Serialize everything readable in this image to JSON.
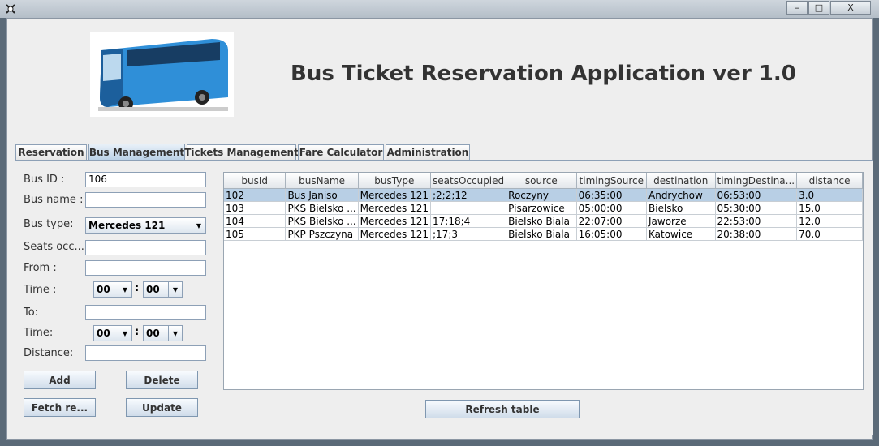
{
  "window": {
    "title": "",
    "minimize_label": "–",
    "maximize_label": "□",
    "close_label": "X"
  },
  "header": {
    "app_title": "Bus Ticket Reservation Application ver 1.0"
  },
  "tabs": [
    {
      "label": "Reservation"
    },
    {
      "label": "Bus Management"
    },
    {
      "label": "Tickets Management"
    },
    {
      "label": "Fare Calculator"
    },
    {
      "label": "Administration"
    }
  ],
  "form": {
    "bus_id_label": "Bus ID :",
    "bus_id_value": "106",
    "bus_name_label": "Bus name :",
    "bus_name_value": "",
    "bus_type_label": "Bus type:",
    "bus_type_value": "Mercedes 121",
    "seats_label": "Seats occ...",
    "seats_value": "",
    "from_label": "From :",
    "from_value": "",
    "time1_label": "Time :",
    "time1_hour": "00",
    "time1_min": "00",
    "to_label": "To:",
    "to_value": "",
    "time2_label": "Time:",
    "time2_hour": "00",
    "time2_min": "00",
    "distance_label": "Distance:",
    "distance_value": "",
    "colon": ":"
  },
  "buttons": {
    "add": "Add",
    "delete": "Delete",
    "fetch": "Fetch re...",
    "update": "Update",
    "refresh": "Refresh table"
  },
  "table": {
    "columns": [
      "busId",
      "busName",
      "busType",
      "seatsOccupied",
      "source",
      "timingSource",
      "destination",
      "timingDestina...",
      "distance"
    ],
    "rows": [
      [
        "102",
        "Bus Janiso",
        "Mercedes 121",
        ";2;2;12",
        "Roczyny",
        "06:35:00",
        "Andrychow",
        "06:53:00",
        "3.0"
      ],
      [
        "103",
        "PKS Bielsko ...",
        "Mercedes 121",
        "",
        "Pisarzowice",
        "05:00:00",
        "Bielsko",
        "05:30:00",
        "15.0"
      ],
      [
        "104",
        "PKS Bielsko ...",
        "Mercedes 121",
        "17;18;4",
        "Bielsko Biala",
        "22:07:00",
        "Jaworze",
        "22:53:00",
        "12.0"
      ],
      [
        "105",
        "PKP Pszczyna",
        "Mercedes 121",
        ";17;3",
        "Bielsko Biala",
        "16:05:00",
        "Katowice",
        "20:38:00",
        "70.0"
      ]
    ],
    "selected_row": 0
  }
}
